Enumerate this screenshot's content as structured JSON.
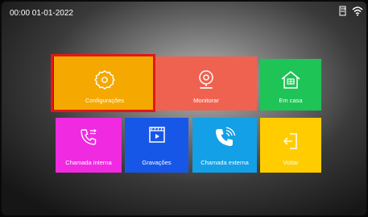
{
  "status_bar": {
    "datetime": "00:00 01-01-2022",
    "icons": [
      "sd-card-icon",
      "wifi-icon"
    ]
  },
  "menu": {
    "tiles": [
      {
        "id": "configuracoes",
        "label": "Configurações",
        "icon": "gear-icon",
        "color": "#f5a800",
        "selected": true
      },
      {
        "id": "monitorar",
        "label": "Monitorar",
        "icon": "camera-icon",
        "color": "#ef6250",
        "selected": false
      },
      {
        "id": "em-casa",
        "label": "Em casa",
        "icon": "house-icon",
        "color": "#1ec456",
        "selected": false
      },
      {
        "id": "chamada-interna",
        "label": "Chamada interna",
        "icon": "phone-internal-icon",
        "color": "#f02ae0",
        "selected": false
      },
      {
        "id": "gravacoes",
        "label": "Gravações",
        "icon": "video-recording-icon",
        "color": "#1757e8",
        "selected": false
      },
      {
        "id": "chamada-externa",
        "label": "Chamada externa",
        "icon": "phone-ringing-icon",
        "color": "#13a0e6",
        "selected": false
      },
      {
        "id": "voltar",
        "label": "Voltar",
        "icon": "exit-icon",
        "color": "#ffcc00",
        "selected": false
      }
    ]
  },
  "colors": {
    "selection_frame": "#e01818"
  }
}
